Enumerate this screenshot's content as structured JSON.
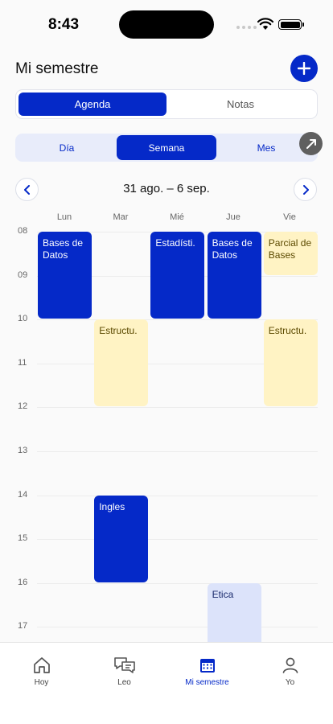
{
  "status_bar": {
    "time": "8:43"
  },
  "header": {
    "title": "Mi semestre"
  },
  "segments": {
    "agenda": "Agenda",
    "notas": "Notas",
    "active": "agenda"
  },
  "view_modes": {
    "day": "Día",
    "week": "Semana",
    "month": "Mes",
    "active": "week"
  },
  "range_label": "31 ago. – 6 sep.",
  "days": [
    "Lun",
    "Mar",
    "Mié",
    "Jue",
    "Vie"
  ],
  "hours": [
    "08",
    "09",
    "10",
    "11",
    "12",
    "13",
    "14",
    "15",
    "16",
    "17"
  ],
  "events": [
    {
      "day": 0,
      "start": 8,
      "end": 10,
      "title": "Bases de Datos",
      "color": "blue"
    },
    {
      "day": 1,
      "start": 10,
      "end": 12,
      "title": "Estructu.",
      "color": "yellow"
    },
    {
      "day": 1,
      "start": 14,
      "end": 16,
      "title": "Ingles",
      "color": "blue"
    },
    {
      "day": 2,
      "start": 8,
      "end": 10,
      "title": "Estadísti.",
      "color": "blue"
    },
    {
      "day": 3,
      "start": 8,
      "end": 10,
      "title": "Bases de Datos",
      "color": "blue"
    },
    {
      "day": 3,
      "start": 16,
      "end": 18,
      "title": "Etica",
      "color": "lavender"
    },
    {
      "day": 4,
      "start": 8,
      "end": 9,
      "title": "Parcial de Bases",
      "color": "yellow"
    },
    {
      "day": 4,
      "start": 10,
      "end": 12,
      "title": "Estructu.",
      "color": "yellow"
    }
  ],
  "tabs": [
    {
      "label": "Hoy",
      "icon": "home-icon"
    },
    {
      "label": "Leo",
      "icon": "chat-icon"
    },
    {
      "label": "Mi semestre",
      "icon": "calendar-icon",
      "active": true
    },
    {
      "label": "Yo",
      "icon": "person-icon"
    }
  ],
  "colors": {
    "accent": "#0529c8",
    "event_blue": "#0529c8",
    "event_yellow": "#fff3c4",
    "event_lavender": "#dce3fa"
  }
}
